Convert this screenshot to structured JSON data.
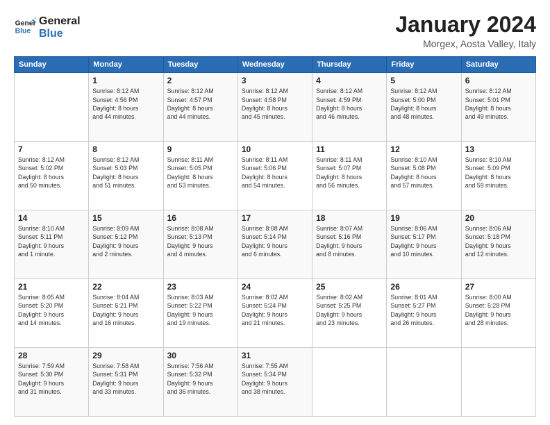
{
  "logo": {
    "line1": "General",
    "line2": "Blue"
  },
  "title": "January 2024",
  "location": "Morgex, Aosta Valley, Italy",
  "weekdays": [
    "Sunday",
    "Monday",
    "Tuesday",
    "Wednesday",
    "Thursday",
    "Friday",
    "Saturday"
  ],
  "weeks": [
    [
      {
        "day": "",
        "info": ""
      },
      {
        "day": "1",
        "info": "Sunrise: 8:12 AM\nSunset: 4:56 PM\nDaylight: 8 hours\nand 44 minutes."
      },
      {
        "day": "2",
        "info": "Sunrise: 8:12 AM\nSunset: 4:57 PM\nDaylight: 8 hours\nand 44 minutes."
      },
      {
        "day": "3",
        "info": "Sunrise: 8:12 AM\nSunset: 4:58 PM\nDaylight: 8 hours\nand 45 minutes."
      },
      {
        "day": "4",
        "info": "Sunrise: 8:12 AM\nSunset: 4:59 PM\nDaylight: 8 hours\nand 46 minutes."
      },
      {
        "day": "5",
        "info": "Sunrise: 8:12 AM\nSunset: 5:00 PM\nDaylight: 8 hours\nand 48 minutes."
      },
      {
        "day": "6",
        "info": "Sunrise: 8:12 AM\nSunset: 5:01 PM\nDaylight: 8 hours\nand 49 minutes."
      }
    ],
    [
      {
        "day": "7",
        "info": "Sunrise: 8:12 AM\nSunset: 5:02 PM\nDaylight: 8 hours\nand 50 minutes."
      },
      {
        "day": "8",
        "info": "Sunrise: 8:12 AM\nSunset: 5:03 PM\nDaylight: 8 hours\nand 51 minutes."
      },
      {
        "day": "9",
        "info": "Sunrise: 8:11 AM\nSunset: 5:05 PM\nDaylight: 8 hours\nand 53 minutes."
      },
      {
        "day": "10",
        "info": "Sunrise: 8:11 AM\nSunset: 5:06 PM\nDaylight: 8 hours\nand 54 minutes."
      },
      {
        "day": "11",
        "info": "Sunrise: 8:11 AM\nSunset: 5:07 PM\nDaylight: 8 hours\nand 56 minutes."
      },
      {
        "day": "12",
        "info": "Sunrise: 8:10 AM\nSunset: 5:08 PM\nDaylight: 8 hours\nand 57 minutes."
      },
      {
        "day": "13",
        "info": "Sunrise: 8:10 AM\nSunset: 5:09 PM\nDaylight: 8 hours\nand 59 minutes."
      }
    ],
    [
      {
        "day": "14",
        "info": "Sunrise: 8:10 AM\nSunset: 5:11 PM\nDaylight: 9 hours\nand 1 minute."
      },
      {
        "day": "15",
        "info": "Sunrise: 8:09 AM\nSunset: 5:12 PM\nDaylight: 9 hours\nand 2 minutes."
      },
      {
        "day": "16",
        "info": "Sunrise: 8:08 AM\nSunset: 5:13 PM\nDaylight: 9 hours\nand 4 minutes."
      },
      {
        "day": "17",
        "info": "Sunrise: 8:08 AM\nSunset: 5:14 PM\nDaylight: 9 hours\nand 6 minutes."
      },
      {
        "day": "18",
        "info": "Sunrise: 8:07 AM\nSunset: 5:16 PM\nDaylight: 9 hours\nand 8 minutes."
      },
      {
        "day": "19",
        "info": "Sunrise: 8:06 AM\nSunset: 5:17 PM\nDaylight: 9 hours\nand 10 minutes."
      },
      {
        "day": "20",
        "info": "Sunrise: 8:06 AM\nSunset: 5:18 PM\nDaylight: 9 hours\nand 12 minutes."
      }
    ],
    [
      {
        "day": "21",
        "info": "Sunrise: 8:05 AM\nSunset: 5:20 PM\nDaylight: 9 hours\nand 14 minutes."
      },
      {
        "day": "22",
        "info": "Sunrise: 8:04 AM\nSunset: 5:21 PM\nDaylight: 9 hours\nand 16 minutes."
      },
      {
        "day": "23",
        "info": "Sunrise: 8:03 AM\nSunset: 5:22 PM\nDaylight: 9 hours\nand 19 minutes."
      },
      {
        "day": "24",
        "info": "Sunrise: 8:02 AM\nSunset: 5:24 PM\nDaylight: 9 hours\nand 21 minutes."
      },
      {
        "day": "25",
        "info": "Sunrise: 8:02 AM\nSunset: 5:25 PM\nDaylight: 9 hours\nand 23 minutes."
      },
      {
        "day": "26",
        "info": "Sunrise: 8:01 AM\nSunset: 5:27 PM\nDaylight: 9 hours\nand 26 minutes."
      },
      {
        "day": "27",
        "info": "Sunrise: 8:00 AM\nSunset: 5:28 PM\nDaylight: 9 hours\nand 28 minutes."
      }
    ],
    [
      {
        "day": "28",
        "info": "Sunrise: 7:59 AM\nSunset: 5:30 PM\nDaylight: 9 hours\nand 31 minutes."
      },
      {
        "day": "29",
        "info": "Sunrise: 7:58 AM\nSunset: 5:31 PM\nDaylight: 9 hours\nand 33 minutes."
      },
      {
        "day": "30",
        "info": "Sunrise: 7:56 AM\nSunset: 5:32 PM\nDaylight: 9 hours\nand 36 minutes."
      },
      {
        "day": "31",
        "info": "Sunrise: 7:55 AM\nSunset: 5:34 PM\nDaylight: 9 hours\nand 38 minutes."
      },
      {
        "day": "",
        "info": ""
      },
      {
        "day": "",
        "info": ""
      },
      {
        "day": "",
        "info": ""
      }
    ]
  ]
}
